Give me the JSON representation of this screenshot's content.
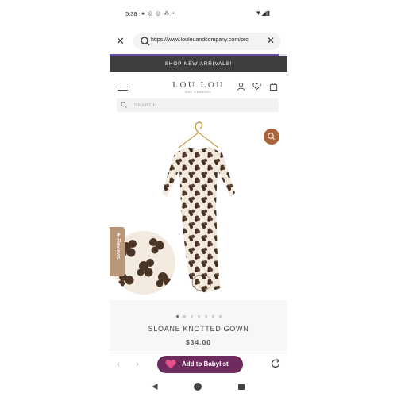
{
  "status_bar": {
    "time": "5:38",
    "left_icons": [
      "chat-icon",
      "instagram-icon",
      "instagram-icon",
      "share-icon",
      "dot-icon"
    ],
    "right_icons": [
      "wifi-icon",
      "signal-icon",
      "battery-icon"
    ]
  },
  "browser": {
    "url": "https://www.loulouandcompany.com/prc",
    "progress": 0.95
  },
  "announcement": "SHOP NEW ARRIVALS!",
  "site_header": {
    "logo_main": "LOU LOU",
    "logo_sub": "AND COMPANY",
    "icons": [
      "menu-icon",
      "account-icon",
      "wishlist-heart-icon",
      "bag-icon"
    ]
  },
  "search": {
    "placeholder": "SEARCH"
  },
  "product": {
    "reviews_label": "★ Reviews",
    "gallery_count": 7,
    "gallery_active_index": 0,
    "name": "SLOANE KNOTTED GOWN",
    "price": "$34.00"
  },
  "toolbar": {
    "babylist_label": "Add to Babylist"
  },
  "colors": {
    "announcement_bg": "#3e3e3e",
    "zoom_button": "#a8653c",
    "reviews_tab": "#b9977b",
    "babylist_button": "#6e2b5d",
    "babylist_heart": "#e8508a",
    "progress_accent": "#6b4fa0"
  }
}
